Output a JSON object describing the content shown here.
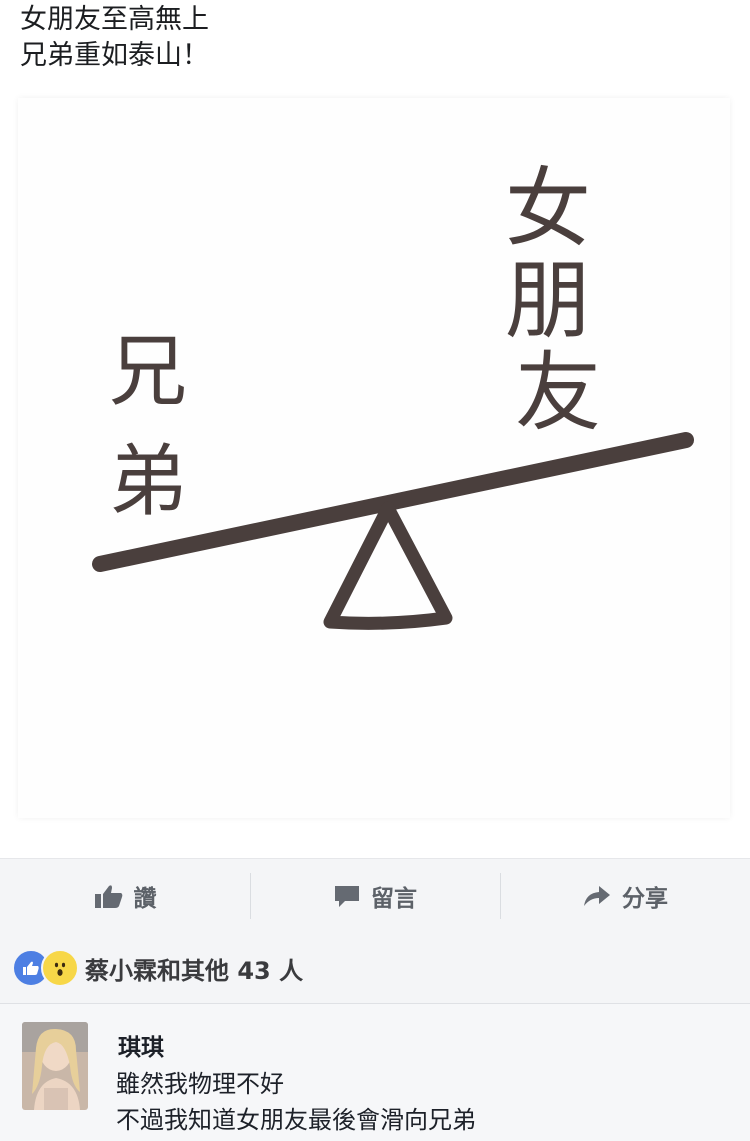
{
  "post": {
    "text_line1": "女朋友至高無上",
    "text_line2": "兄弟重如泰山！"
  },
  "image": {
    "label_left": "兄弟",
    "label_right": "女朋友"
  },
  "actions": {
    "like": "讚",
    "comment": "留言",
    "share": "分享"
  },
  "reactions": {
    "summary": "蔡小霖和其他 43 人"
  },
  "comment": {
    "author": "琪琪",
    "line1": "雖然我物理不好",
    "line2": "不過我知道女朋友最後會滑向兄弟"
  },
  "colors": {
    "seesaw": "#4a3f3d",
    "action_text": "#5c6168",
    "like_reaction": "#4d7fe3",
    "wow_reaction": "#f7d748"
  },
  "icons": [
    "thumbs-up-icon",
    "speech-bubble-icon",
    "share-arrow-icon",
    "like-reaction-icon",
    "wow-reaction-icon"
  ]
}
